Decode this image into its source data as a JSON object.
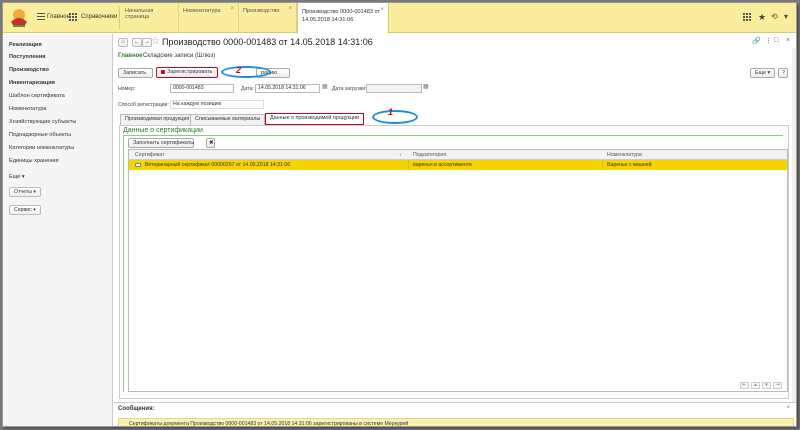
{
  "topbar": {
    "home_label": "Главное",
    "reference_label": "Справочники",
    "tabs": [
      {
        "label": "Начальная страница"
      },
      {
        "label": "Номенклатура"
      },
      {
        "label": "Производство"
      },
      {
        "label": "Производство 0000-001483 от 14.05.2018 14:31:06"
      }
    ]
  },
  "sidebar": {
    "items": [
      {
        "label": "Реализация",
        "bold": true
      },
      {
        "label": "Поступления",
        "bold": true
      },
      {
        "label": "Производство",
        "bold": true
      },
      {
        "label": "Инвентаризация",
        "bold": true
      },
      {
        "label": "Шаблон сертификата"
      },
      {
        "label": "Номенклатура"
      },
      {
        "label": "Хозяйствующие субъекты"
      },
      {
        "label": "Поднадзорные объекты"
      },
      {
        "label": "Категории номенклатуры"
      },
      {
        "label": "Единицы хранения"
      },
      {
        "label": "Еще ▾"
      }
    ],
    "reports_label": "Отчеты ▾",
    "service_label": "Сервис ▾"
  },
  "document": {
    "title": "Производство 0000-001483 от 14.05.2018 14:31:06",
    "nav_main": "Главное",
    "nav_warehouse": "Складские записи (Шлюз)",
    "record_button": "Записать",
    "register_button": "Зарегистрировать",
    "third_button_partial": "рацию",
    "more_button": "Еще ▾",
    "help_button": "?",
    "number_label": "Номер:",
    "number_value": "0000-001483",
    "date_label": "Дата:",
    "date_value": "14.05.2018 14:31:06",
    "load_date_label": "Дата загрузки:",
    "load_date_value": "",
    "reg_method_label": "Способ регистрации:",
    "reg_method_value": "На каждую позицию"
  },
  "form_tabs": [
    {
      "label": "Производимая продукция"
    },
    {
      "label": "Списываемые материалы"
    },
    {
      "label": "Данные о производимой продукции"
    }
  ],
  "certs": {
    "section_title": "Данные о сертификации",
    "fill_button": "Заполнить сертификаты",
    "columns": [
      "Сертификат",
      "Подкатегория",
      "Номенклатура"
    ],
    "sort_mark": "↓",
    "rows": [
      {
        "certificate": "Ветеринарный сертификат 00000267 от 14.05.2018 14:31:06",
        "subcategory": "варенья в ассортименте",
        "nomenclature": "Варенье с вишней"
      }
    ]
  },
  "annotations": {
    "one": "1",
    "two": "2"
  },
  "messages": {
    "title": "Сообщения:",
    "close": "×",
    "rows": [
      {
        "text": "Сертификаты документа Производство 0000-001483 от 14.05.2018 14:31:06 зарегистрированы в системе Меркурий"
      }
    ]
  },
  "colors": {
    "accent": "#f6d400",
    "annotation": "#d0021b",
    "oval": "#1e8fd5",
    "topbar": "#fbed9e"
  }
}
